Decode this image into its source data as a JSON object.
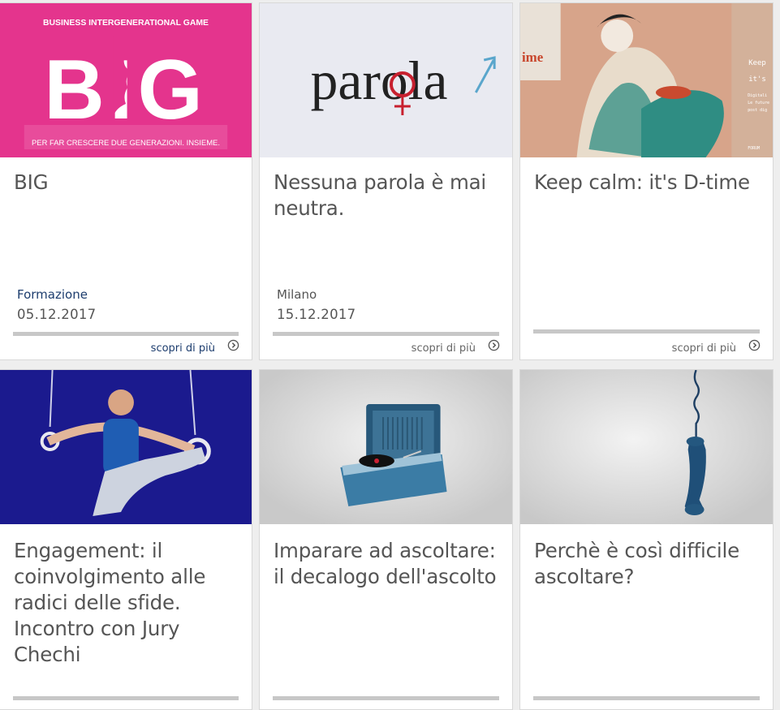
{
  "cards": [
    {
      "title": "BIG",
      "category": "Formazione",
      "date": "05.12.2017",
      "more_label": "scopri di più",
      "image": {
        "top_text": "BUSINESS INTERGENERATIONAL GAME",
        "logo": "BIG",
        "bottom_text": "PER FAR CRESCERE DUE GENERAZIONI. INSIEME.",
        "bg": "#e4348d"
      }
    },
    {
      "title": "Nessuna parola è mai neutra.",
      "category": "Milano",
      "date": "15.12.2017",
      "more_label": "scopri di più",
      "image": {
        "word": "parola",
        "bg": "#e9eaf1"
      }
    },
    {
      "title": "Keep calm: it's D-time",
      "more_label": "scopri di più",
      "image": {
        "badge": "ime",
        "poster_text": [
          "Keep",
          "it's",
          "Digitali",
          "Le future",
          "post dig",
          "FORUM"
        ]
      }
    },
    {
      "title": "Engagement: il coinvolgimento alle radici delle sfide. Incontro con Jury Chechi"
    },
    {
      "title": "Imparare ad ascoltare: il decalogo dell'ascolto"
    },
    {
      "title": "Perchè è così difficile ascoltare?"
    }
  ],
  "colors": {
    "accent_blue": "#1d3d6e",
    "text_gray": "#555555",
    "bar_gray": "#c7c7c7"
  }
}
